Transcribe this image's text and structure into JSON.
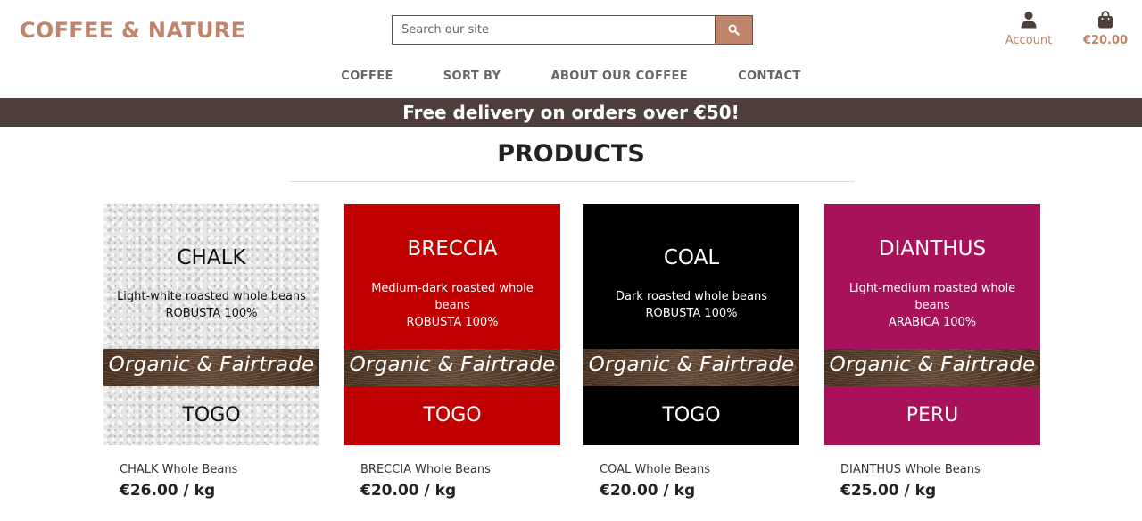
{
  "header": {
    "logo": "COFFEE & NATURE",
    "search_placeholder": "Search our site",
    "account_label": "Account",
    "bag_total": "€20.00"
  },
  "nav": {
    "items": [
      "COFFEE",
      "SORT BY",
      "ABOUT OUR COFFEE",
      "CONTACT"
    ]
  },
  "banner": "Free delivery on orders over €50!",
  "page_title": "PRODUCTS",
  "products": [
    {
      "label_name": "CHALK",
      "desc_1": "Light-white roasted whole beans",
      "desc_2": "ROBUSTA 100%",
      "band": "Organic & Fairtrade",
      "origin": "TOGO",
      "title": "CHALK Whole Beans",
      "price": "€26.00 / kg"
    },
    {
      "label_name": "BRECCIA",
      "desc_1": "Medium-dark roasted whole beans",
      "desc_2": "ROBUSTA 100%",
      "band": "Organic & Fairtrade",
      "origin": "TOGO",
      "title": "BRECCIA Whole Beans",
      "price": "€20.00 / kg"
    },
    {
      "label_name": "COAL",
      "desc_1": "Dark roasted whole beans",
      "desc_2": "ROBUSTA 100%",
      "band": "Organic & Fairtrade",
      "origin": "TOGO",
      "title": "COAL Whole Beans",
      "price": "€20.00 / kg"
    },
    {
      "label_name": "DIANTHUS",
      "desc_1": "Light-medium roasted whole beans",
      "desc_2": "ARABICA 100%",
      "band": "Organic & Fairtrade",
      "origin": "PERU",
      "title": "DIANTHUS Whole Beans",
      "price": "€25.00 / kg"
    }
  ],
  "colors": {
    "brand": "#c0846a",
    "banner": "#4e3f3c",
    "breccia": "#c00000",
    "coal": "#000000",
    "dianthus": "#a8125a"
  },
  "icons": [
    "search-icon",
    "user-icon",
    "shopping-bag-icon"
  ]
}
